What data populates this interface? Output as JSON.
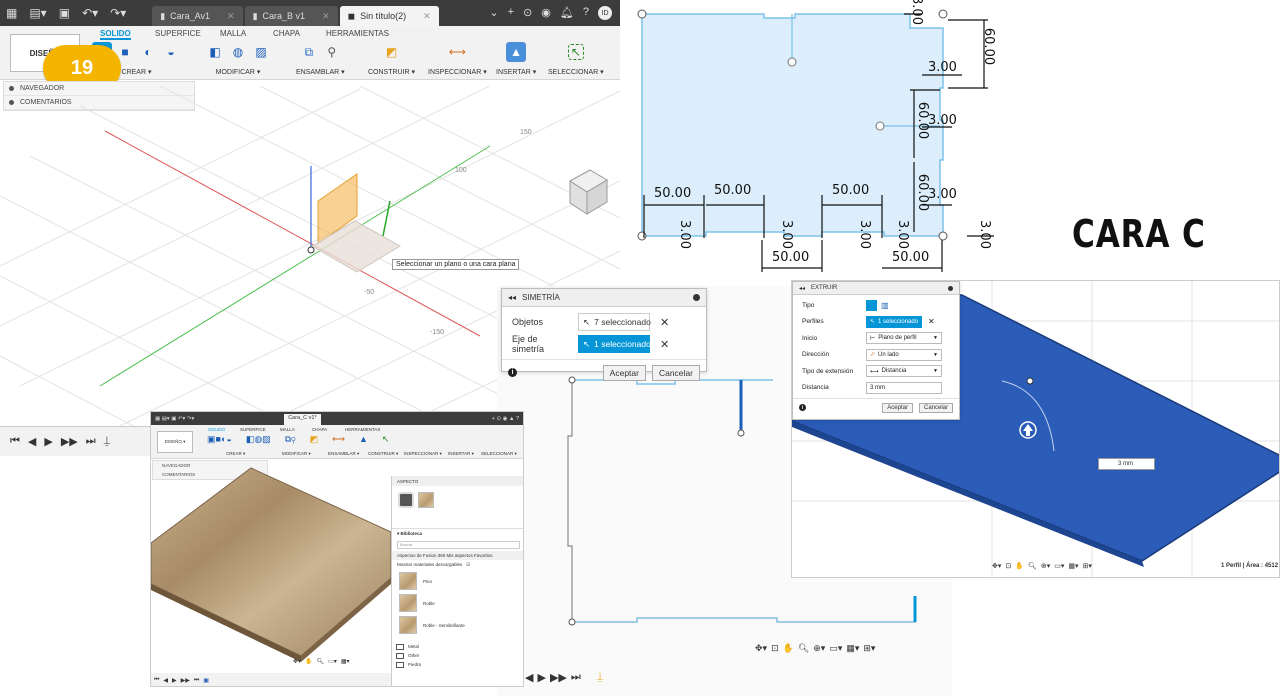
{
  "main": {
    "tabs": [
      {
        "label": "Cara_Av1"
      },
      {
        "label": "Cara_B v1"
      },
      {
        "label": "Sin título(2)"
      }
    ],
    "user_initials": "ID",
    "design_label": "DISEÑO",
    "ribbon_tabs": [
      "SOLIDO",
      "SUPERFICE",
      "MALLA",
      "CHAPA",
      "HERRAMIENTAS"
    ],
    "groups": {
      "crear": "CREAR ▾",
      "modificar": "MODIFICAR ▾",
      "ensamblar": "ENSAMBLAR ▾",
      "construir": "CONSTRUIR ▾",
      "inspeccionar": "INSPECCIONAR ▾",
      "insertar": "INSERTAR ▾",
      "seleccionar": "SELECCIONAR ▾"
    },
    "step_badge": "19",
    "browser": {
      "navigator": "NAVEGADOR",
      "comments": "COMENTARIOS"
    },
    "tooltip": "Seleccionar un plano o una cara plana",
    "axis_labels": {
      "a": "150",
      "b": "100",
      "c": "-50",
      "d": "-150"
    }
  },
  "sketch_dims": {
    "d1": "3.00",
    "d2": "60.00",
    "d3": "3.00",
    "d4": "60.00",
    "d5": "3.00",
    "d6": "60.00",
    "d7": "3.00",
    "d8": "50.00",
    "d9": "50.00",
    "d10": "50.00",
    "d11": "3.00",
    "d12": "3.00",
    "d13": "3.00",
    "d14": "3.00",
    "d15": "50.00",
    "d16": "50.00",
    "d17": "3.00"
  },
  "cara_title": "CARA C",
  "simetria": {
    "title": "SIMETRÍA",
    "objects_label": "Objetos",
    "objects_value": "7 seleccionado",
    "axis_label": "Eje de simetría",
    "axis_value": "1 seleccionado",
    "accept": "Aceptar",
    "cancel": "Cancelar"
  },
  "extruir": {
    "title": "EXTRUIR",
    "rows": [
      {
        "label": "Tipo",
        "value": ""
      },
      {
        "label": "Perfiles",
        "value": "1 seleccionado"
      },
      {
        "label": "Inicio",
        "value": "Plano de perfil"
      },
      {
        "label": "Dirección",
        "value": "Un lado"
      },
      {
        "label": "Tipo de extensión",
        "value": "Distancia"
      },
      {
        "label": "Distancia",
        "value": "3 mm"
      }
    ],
    "accept": "Aceptar",
    "cancel": "Cancelar",
    "input_value": "3 mm",
    "status": "1 Perfil | Área : 4512"
  },
  "material": {
    "design_label": "DISEÑO ▾",
    "tab": "Cara_C v1*",
    "aspect_title": "ASPECTO",
    "library": "▾ Biblioteca",
    "search": "Buscar",
    "lib_tabs": "Aspectos de Fusion 360   Mis aspectos   Favoritos",
    "show": "Mostrar materiales descargables",
    "items": [
      "Pino",
      "Roble",
      "Roble - Semibrillante"
    ],
    "folders": [
      "Metal",
      "Other",
      "Piedra"
    ],
    "browser": {
      "navigator": "NAVEGADOR",
      "comments": "COMENTARIOS"
    }
  },
  "colors": {
    "accent": "#0696d7",
    "badge": "#f4b400",
    "blue_face": "#2a5cb8",
    "sketch_fill": "#dceefb"
  }
}
